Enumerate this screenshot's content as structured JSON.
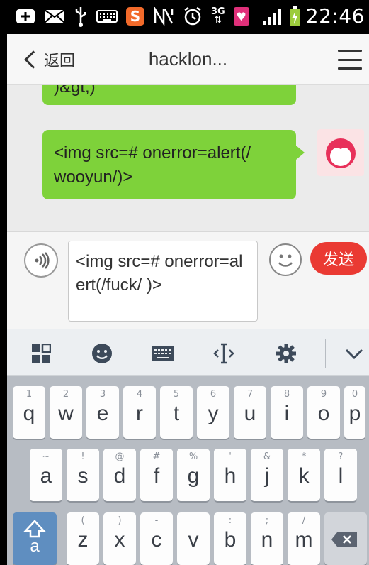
{
  "status_bar": {
    "time": "22:46",
    "network": "3G",
    "icons": [
      "add-icon",
      "mail-icon",
      "usb-icon",
      "keyboard-icon",
      "sogou-icon",
      "nfc-icon",
      "alarm-icon",
      "network-3g-icon",
      "heart-icon",
      "signal-icon",
      "battery-charging-icon"
    ]
  },
  "header": {
    "back_label": "返回",
    "title": "hacklon...",
    "menu_icon": "menu-icon"
  },
  "messages": [
    {
      "id": "partial",
      "text": ")&gt;)",
      "side": "right"
    },
    {
      "id": "sent",
      "text": "<img src=# onerror=alert(/ wooyun/)>",
      "side": "right",
      "avatar_icon": "avatar-girl-icon"
    }
  ],
  "composer": {
    "voice_icon": "voice-icon",
    "input_value": "<img src=# onerror=alert(/fuck/ )>",
    "emoji_icon": "emoji-icon",
    "send_label": "发送"
  },
  "keyboard_toolbar": {
    "items": [
      "apps-icon",
      "emoji-face-icon",
      "keyboard-icon",
      "cursor-icon",
      "settings-icon",
      "collapse-icon"
    ]
  },
  "keyboard": {
    "row1": [
      {
        "hint": "1",
        "key": "q"
      },
      {
        "hint": "2",
        "key": "w"
      },
      {
        "hint": "3",
        "key": "e"
      },
      {
        "hint": "4",
        "key": "r"
      },
      {
        "hint": "5",
        "key": "t"
      },
      {
        "hint": "6",
        "key": "y"
      },
      {
        "hint": "7",
        "key": "u"
      },
      {
        "hint": "8",
        "key": "i"
      },
      {
        "hint": "9",
        "key": "o"
      },
      {
        "hint": "0",
        "key": "p"
      }
    ],
    "row2": [
      {
        "hint": "~",
        "key": "a"
      },
      {
        "hint": "!",
        "key": "s"
      },
      {
        "hint": "@",
        "key": "d"
      },
      {
        "hint": "#",
        "key": "f"
      },
      {
        "hint": "%",
        "key": "g"
      },
      {
        "hint": "'",
        "key": "h"
      },
      {
        "hint": "&",
        "key": "j"
      },
      {
        "hint": "*",
        "key": "k"
      },
      {
        "hint": "?",
        "key": "l"
      }
    ],
    "row3": [
      {
        "hint": "(",
        "key": "z"
      },
      {
        "hint": ")",
        "key": "x"
      },
      {
        "hint": "-",
        "key": "c"
      },
      {
        "hint": "_",
        "key": "v"
      },
      {
        "hint": ":",
        "key": "b"
      },
      {
        "hint": ";",
        "key": "n"
      },
      {
        "hint": "/",
        "key": "m"
      }
    ],
    "shift_label": "a"
  }
}
